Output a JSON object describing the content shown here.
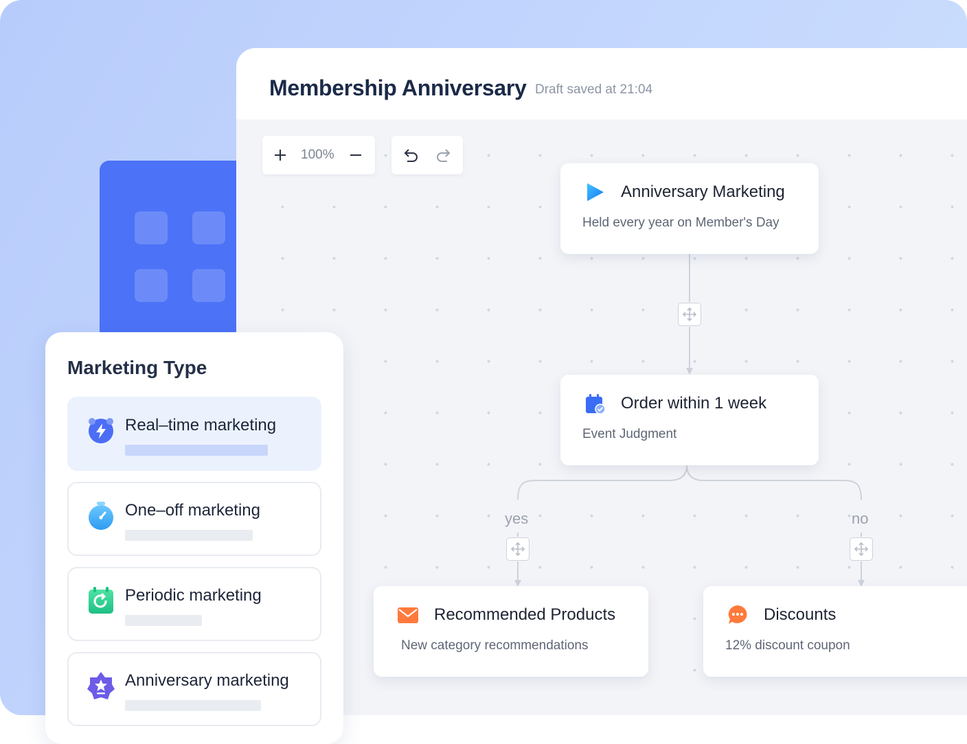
{
  "editor": {
    "title": "Membership Anniversary",
    "draft_status": "Draft saved at 21:04"
  },
  "toolbar": {
    "zoom_in_icon": "plus-icon",
    "zoom_level": "100%",
    "zoom_out_icon": "minus-icon",
    "undo_icon": "undo-icon",
    "redo_icon": "redo-icon"
  },
  "flow": {
    "trigger": {
      "icon": "play-icon",
      "title": "Anniversary Marketing",
      "subtitle": "Held every year on Member's Day"
    },
    "condition": {
      "icon": "calendar-check-icon",
      "title": "Order within 1 week",
      "subtitle": "Event Judgment"
    },
    "branches": {
      "yes_label": "yes",
      "no_label": "no"
    },
    "actions": [
      {
        "icon": "envelope-icon",
        "title": "Recommended Products",
        "subtitle": "New category recommendations"
      },
      {
        "icon": "chat-bubble-icon",
        "title": "Discounts",
        "subtitle": "12% discount coupon"
      }
    ]
  },
  "marketing_type": {
    "title": "Marketing Type",
    "selected": "Real–time marketing",
    "items": [
      {
        "label": "Real–time marketing",
        "icon": "lightning-alarm-icon"
      },
      {
        "label": "One–off marketing",
        "icon": "stopwatch-icon"
      },
      {
        "label": "Periodic marketing",
        "icon": "refresh-calendar-icon"
      },
      {
        "label": "Anniversary marketing",
        "icon": "star-badge-icon"
      }
    ]
  },
  "colors": {
    "background": "#c3d6fd",
    "tile_blue": "#4c72f7",
    "active_item": "#ebf2fe",
    "title_text": "#1b2a48",
    "muted_text": "#8c95a5",
    "canvas": "#f3f4f8"
  }
}
